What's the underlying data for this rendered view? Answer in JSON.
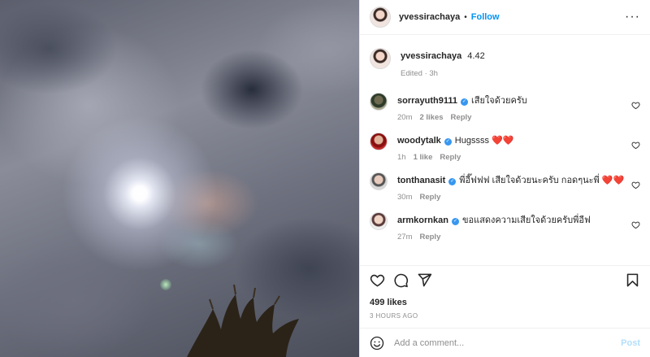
{
  "photo": {
    "alt_icon": "sky-photo"
  },
  "header": {
    "username": "yvessirachaya",
    "separator": "•",
    "follow_label": "Follow",
    "more_glyph": "···"
  },
  "caption": {
    "username": "yvessirachaya",
    "text": "4.42",
    "edited": "Edited · 3h"
  },
  "comments": [
    {
      "username": "sorrayuth9111",
      "verified": true,
      "text": "เสียใจด้วยครับ",
      "time": "20m",
      "likes": "2 likes",
      "reply": "Reply"
    },
    {
      "username": "woodytalk",
      "verified": true,
      "text": "Hugssss ❤️❤️",
      "time": "1h",
      "likes": "1 like",
      "reply": "Reply"
    },
    {
      "username": "tonthanasit",
      "verified": true,
      "text": "พี่อี๊ฟฟฟ เสียใจด้วยนะครับ กอดๆนะพี่ ❤️❤️",
      "time": "30m",
      "likes": "",
      "reply": "Reply"
    },
    {
      "username": "armkornkan",
      "verified": true,
      "text": "ขอแสดงความเสียใจด้วยครับพี่อีฟ",
      "time": "27m",
      "likes": "",
      "reply": "Reply"
    }
  ],
  "actions": {
    "like_icon": "heart-icon",
    "comment_icon": "comment-icon",
    "share_icon": "share-icon",
    "save_icon": "bookmark-icon"
  },
  "likes_text": "499 likes",
  "date_text": "3 HOURS AGO",
  "composer": {
    "placeholder": "Add a comment...",
    "post_label": "Post"
  },
  "colors": {
    "accent": "#0095f6",
    "post_disabled": "#b2dffc",
    "heart": "#ed4956",
    "verified": "#3897f0"
  }
}
